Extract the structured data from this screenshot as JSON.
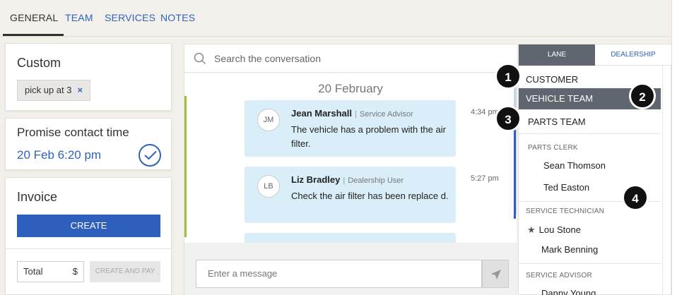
{
  "top_tabs": [
    {
      "label": "GENERAL",
      "active": true
    },
    {
      "label": "TEAM",
      "active": false
    },
    {
      "label": "SERVICES",
      "active": false
    },
    {
      "label": "NOTES",
      "active": false
    }
  ],
  "custom_card": {
    "title": "Custom",
    "tag_label": "pick up at 3",
    "tag_remove": "×"
  },
  "promise_card": {
    "title": "Promise contact time",
    "value": "20 Feb 6:20 pm"
  },
  "invoice_card": {
    "title": "Invoice",
    "create_label": "CREATE",
    "total_placeholder": "Total",
    "currency": "$",
    "create_pay_label": "CREATE AND PAY"
  },
  "conversation": {
    "search_placeholder": "Search the conversation",
    "date_header": "20 February",
    "messages": [
      {
        "initials": "JM",
        "sender": "Jean Marshall",
        "role": "Service Advisor",
        "text": "The vehicle has a problem with the air filter.",
        "time": "4:34 pm"
      },
      {
        "initials": "LB",
        "sender": "Liz Bradley",
        "role": "Dealership User",
        "text": "Check the air filter has been replace d.",
        "time": "5:27 pm"
      }
    ],
    "separator": "|",
    "message_placeholder": "Enter a message"
  },
  "team_panel": {
    "tabs": [
      {
        "label": "LANE",
        "active": true
      },
      {
        "label": "DEALERSHIP",
        "active": false
      }
    ],
    "customer": "CUSTOMER",
    "vehicle_team": "VEHICLE TEAM",
    "parts_team": "PARTS TEAM",
    "parts_clerk_label": "PARTS CLERK",
    "parts_clerks": [
      "Sean Thomson",
      "Ted Easton"
    ],
    "service_tech_label": "SERVICE TECHNICIAN",
    "star": "★",
    "service_techs": [
      "Lou Stone",
      "Mark Benning"
    ],
    "service_advisor_label": "SERVICE ADVISOR",
    "service_advisors": [
      "Danny Young"
    ]
  },
  "callouts": [
    "1",
    "2",
    "3",
    "4"
  ],
  "colors": {
    "accent": "#2f5fbd",
    "lane_active": "#5f6670",
    "bubble": "#d9eef8",
    "green_marker": "#9cc23a"
  }
}
